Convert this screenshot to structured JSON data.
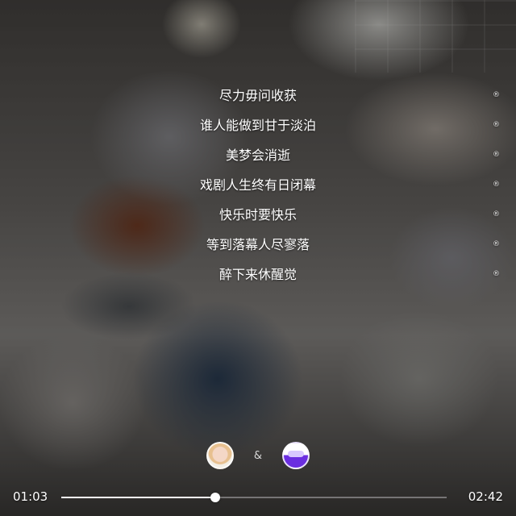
{
  "lyrics": [
    {
      "text": "尽力毋问收获",
      "mark": "®"
    },
    {
      "text": "谁人能做到甘于淡泊",
      "mark": "®"
    },
    {
      "text": "美梦会消逝",
      "mark": "®"
    },
    {
      "text": "戏剧人生终有日闭幕",
      "mark": "®"
    },
    {
      "text": "快乐时要快乐",
      "mark": "®"
    },
    {
      "text": "等到落幕人尽寥落",
      "mark": "®"
    },
    {
      "text": "醉下来休醒觉",
      "mark": "®"
    }
  ],
  "artists": {
    "separator": "&"
  },
  "player": {
    "current_time": "01:03",
    "total_time": "02:42",
    "progress": 0.4
  }
}
